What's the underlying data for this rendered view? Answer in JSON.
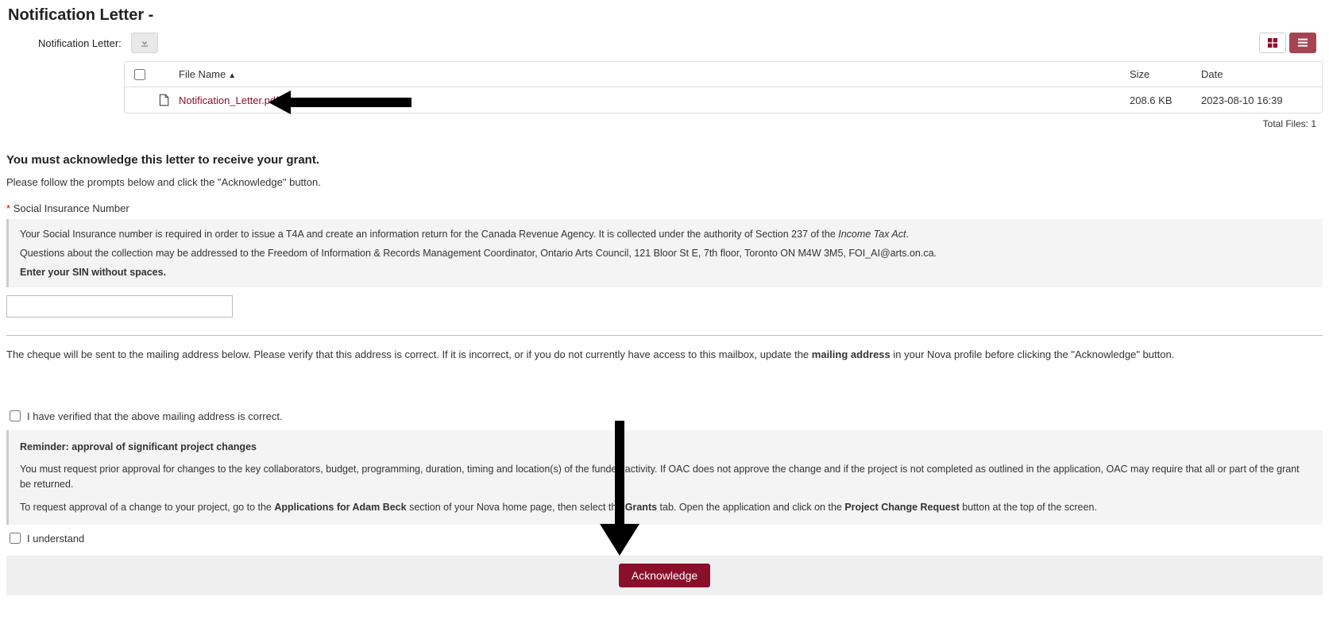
{
  "page": {
    "title": "Notification Letter -",
    "field_label": "Notification Letter:"
  },
  "table": {
    "headers": {
      "file_name": "File Name",
      "size": "Size",
      "date": "Date"
    },
    "rows": [
      {
        "name": "Notification_Letter.pdf",
        "size": "208.6 KB",
        "date": "2023-08-10 16:39"
      }
    ],
    "total": "Total Files: 1"
  },
  "ack_section": {
    "heading": "You must acknowledge this letter to receive your grant.",
    "subtext": "Please follow the prompts below and click the \"Acknowledge\" button."
  },
  "sin": {
    "label": "Social Insurance Number",
    "info_p1_a": "Your Social Insurance number is required in order to issue a T4A and create an information return for the Canada Revenue Agency. It is collected under the authority of Section 237 of the ",
    "info_p1_em": "Income Tax Act",
    "info_p1_b": ".",
    "info_p2": "Questions about the collection may be addressed to the Freedom of Information & Records Management Coordinator, Ontario Arts Council, 121 Bloor St E, 7th floor, Toronto ON M4W 3M5, FOI_AI@arts.on.ca.",
    "info_p3": "Enter your SIN without spaces."
  },
  "mailing": {
    "para_a": "The cheque will be sent to the mailing address below. Please verify that this address is correct. If it is incorrect, or if you do not currently have access to this mailbox, update the ",
    "para_b": "mailing address",
    "para_c": " in your Nova profile before clicking the \"Acknowledge\" button.",
    "verify_label": "I have verified that the above mailing address is correct."
  },
  "reminder": {
    "title": "Reminder: approval of significant project changes",
    "p2": "You must request prior approval for changes to the key collaborators, budget, programming, duration, timing and location(s) of the funded activity. If OAC does not approve the change and if the project is not completed as outlined in the application, OAC may require that all or part of the grant be returned.",
    "p3_a": "To request approval of a change to your project, go to the ",
    "p3_b": "Applications for Adam Beck",
    "p3_c": " section of your Nova home page, then select the ",
    "p3_d": "Grants",
    "p3_e": " tab. Open the application and click on the ",
    "p3_f": "Project Change Request",
    "p3_g": " button at the top of the screen.",
    "understand_label": "I understand"
  },
  "buttons": {
    "acknowledge": "Acknowledge"
  }
}
